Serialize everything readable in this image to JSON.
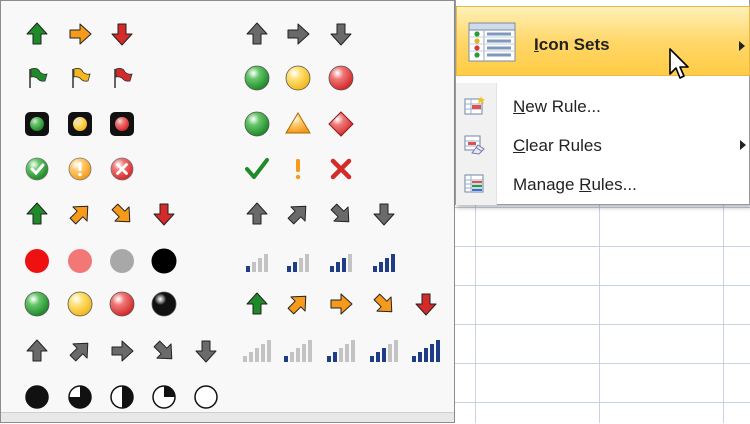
{
  "gallery": {
    "rows": [
      {
        "left_set": "3 Arrows (Colored)",
        "right_set": "3 Arrows (Gray)"
      },
      {
        "left_set": "3 Flags",
        "right_set": "3 Traffic Lights (Unrimmed)"
      },
      {
        "left_set": "3 Traffic Lights (Rimmed)",
        "right_set": "3 Signs"
      },
      {
        "left_set": "3 Symbols (Circled)",
        "right_set": "3 Symbols (Uncircled)"
      },
      {
        "left_set": "4 Arrows (Colored)",
        "right_set": "4 Arrows (Gray)"
      },
      {
        "left_set": "Red To Black",
        "right_set": "4 Ratings"
      },
      {
        "left_set": "4 Traffic Lights",
        "right_set": "5 Arrows (Colored)"
      },
      {
        "left_set": "5 Arrows (Gray)",
        "right_set": "5 Ratings"
      },
      {
        "left_set": "5 Quarters",
        "right_set": ""
      }
    ],
    "colors": {
      "green": "#1f8a2a",
      "yellow": "#f4b81c",
      "red": "#d42a2a",
      "orange": "#f59a1a",
      "gray": "#6a6a6a",
      "navy": "#1f3d86"
    }
  },
  "menu": {
    "icon_sets": {
      "label_u": "I",
      "label_rest": "con Sets",
      "icon": "icon-sets-icon"
    },
    "new_rule": {
      "label_u": "N",
      "label_rest": "ew Rule...",
      "icon": "new-rule-icon"
    },
    "clear_rules": {
      "label_u": "C",
      "label_rest": "lear Rules",
      "icon": "clear-rules-icon"
    },
    "manage_rules": {
      "label_pre": "Manage ",
      "label_u": "R",
      "label_rest": "ules...",
      "icon": "manage-rules-icon"
    }
  }
}
